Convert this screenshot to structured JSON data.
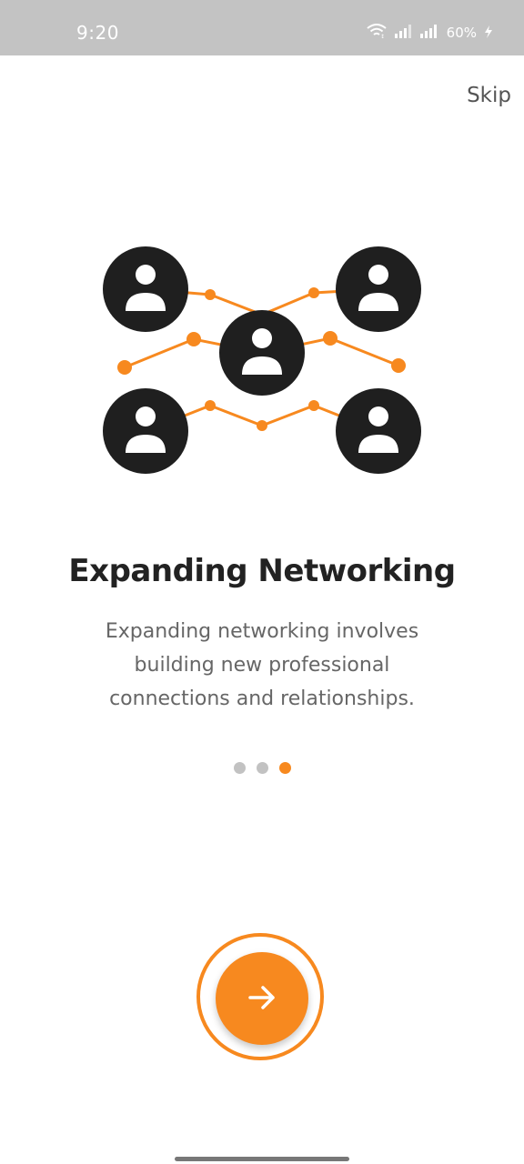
{
  "status_bar": {
    "time": "9:20",
    "battery": "60%",
    "icons": [
      "wifi-icon",
      "signal-icon",
      "signal-icon",
      "battery-charging-icon"
    ]
  },
  "onboarding": {
    "skip_label": "Skip",
    "title": "Expanding Networking",
    "description": "Expanding networking involves building new professional connections and relationships.",
    "illustration_icon": "network-people-icon",
    "page_count": 3,
    "current_page": 3,
    "next_button_icon": "arrow-right-icon"
  },
  "colors": {
    "accent": "#f7891f",
    "status_bar_bg": "#c3c3c3",
    "title_text": "#222222",
    "body_text": "#666666",
    "inactive_dot": "#c2c2c2",
    "avatar_circle": "#1f1f1f"
  }
}
